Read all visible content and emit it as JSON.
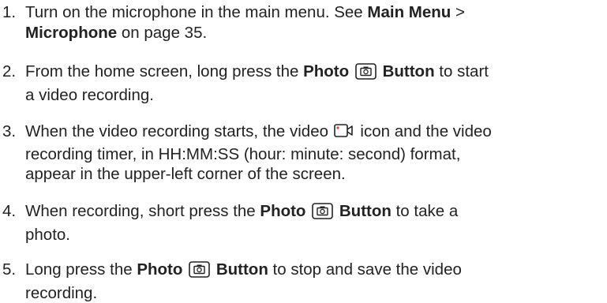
{
  "steps": [
    {
      "number": "1.",
      "t1": "Turn on the microphone in the main menu. See ",
      "b1": "Main Menu",
      "t2": " >",
      "b2": "Microphone",
      "t3": " on page 35."
    },
    {
      "number": "2.",
      "t1": "From the home screen, long press the ",
      "b1": "Photo",
      "b2": "Button",
      "t2": " to start",
      "t3": "a video recording."
    },
    {
      "number": "3.",
      "t1": "When the video recording starts, the video ",
      "t2": " icon and the video",
      "t3": "recording timer, in HH:MM:SS (hour: minute: second) format,",
      "t4": "appear in the upper-left corner of the screen."
    },
    {
      "number": "4.",
      "t1": "When recording, short press the ",
      "b1": "Photo",
      "b2": "Button",
      "t2": " to take a",
      "t3": "photo."
    },
    {
      "number": "5.",
      "t1": "Long press the ",
      "b1": "Photo",
      "b2": "Button",
      "t2": " to stop and save the video",
      "t3": "recording."
    }
  ],
  "icons": {
    "photo_button": "camera-button-icon",
    "video": "video-camera-icon",
    "recording_dot_color": "#e53935"
  }
}
